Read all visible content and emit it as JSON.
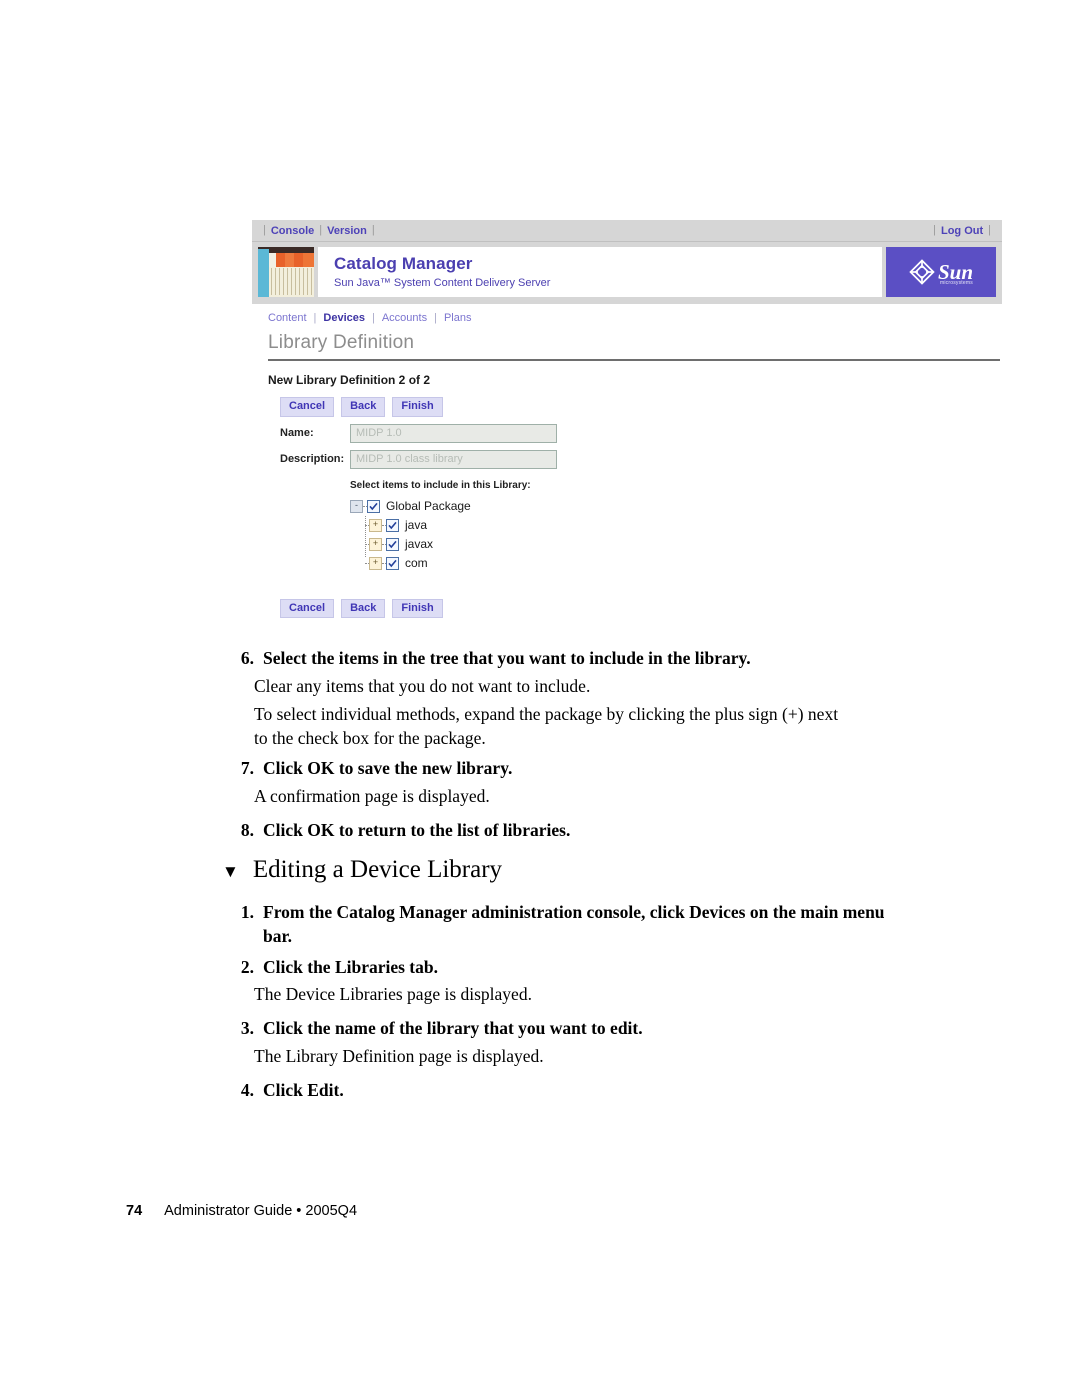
{
  "screenshot": {
    "topbar": {
      "links": [
        "Console",
        "Version"
      ],
      "logout": "Log Out",
      "separator": "|"
    },
    "brand": {
      "title": "Catalog Manager",
      "subtitle": "Sun Java™ System Content Delivery Server",
      "logo_word": "Sun",
      "logo_micro": "microsystems"
    },
    "subnav": {
      "items": [
        "Content",
        "Devices",
        "Accounts",
        "Plans"
      ],
      "active": "Devices",
      "separator": "|"
    },
    "page_title": "Library Definition",
    "wizard_title": "New Library Definition 2 of 2",
    "buttons": [
      "Cancel",
      "Back",
      "Finish"
    ],
    "fields": [
      {
        "label": "Name:",
        "value": "MIDP 1.0"
      },
      {
        "label": "Description:",
        "value": "MIDP 1.0 class library"
      }
    ],
    "tree_intro": "Select items to include in this Library:",
    "tree": [
      {
        "label": "Global Package",
        "toggle": "-",
        "checked": true,
        "level": 0
      },
      {
        "label": "java",
        "toggle": "+",
        "checked": true,
        "level": 1
      },
      {
        "label": "javax",
        "toggle": "+",
        "checked": true,
        "level": 1
      },
      {
        "label": "com",
        "toggle": "+",
        "checked": true,
        "level": 1
      }
    ],
    "colors": {
      "brand_purple": "#5b4fc4",
      "link_blue": "#4d42b8",
      "button_bg": "#ddddf5",
      "header_gray": "#d6d6d6"
    }
  },
  "doc": {
    "step6": {
      "num": "6.",
      "text": "Select the items in the tree that you want to include in the library."
    },
    "step6_p1": "Clear any items that you do not want to include.",
    "step6_p2_l1": "To select individual methods, expand the package by clicking the plus sign (+) next",
    "step6_p2_l2": "to the check box for the package.",
    "step7": {
      "num": "7.",
      "text": "Click OK to save the new library."
    },
    "step7_p1": "A confirmation page is displayed.",
    "step8": {
      "num": "8.",
      "text": "Click OK to return to the list of libraries."
    },
    "heading": {
      "marker": "▼",
      "text": "Editing a Device Library"
    },
    "step1": {
      "num": "1.",
      "line1": "From the Catalog Manager administration console, click Devices on the main",
      "line2": "menu bar."
    },
    "step2": {
      "num": "2.",
      "text": "Click the Libraries tab."
    },
    "step2_p1": "The Device Libraries page is displayed.",
    "step3": {
      "num": "3.",
      "text": "Click the name of the library that you want to edit."
    },
    "step3_p1": "The Library Definition page is displayed.",
    "step4": {
      "num": "4.",
      "text": "Click Edit."
    },
    "footer": {
      "page": "74",
      "text": "Administrator Guide • 2005Q4"
    }
  }
}
